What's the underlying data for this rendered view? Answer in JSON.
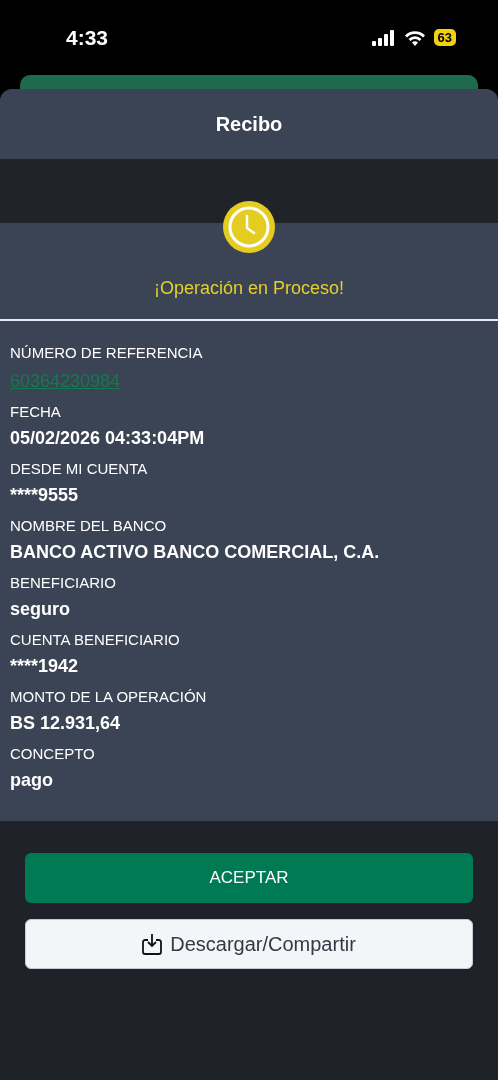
{
  "status_bar": {
    "time": "4:33",
    "battery": "63"
  },
  "header": {
    "title": "Recibo"
  },
  "status": {
    "text": "¡Operación en Proceso!"
  },
  "fields": [
    {
      "label": "NÚMERO DE REFERENCIA",
      "value": "60364230984",
      "kind": "link"
    },
    {
      "label": "FECHA",
      "value": "05/02/2026 04:33:04PM",
      "kind": "text"
    },
    {
      "label": "DESDE MI CUENTA",
      "value": "****9555",
      "kind": "text"
    },
    {
      "label": "NOMBRE DEL BANCO",
      "value": "BANCO ACTIVO BANCO COMERCIAL, C.A.",
      "kind": "text"
    },
    {
      "label": "BENEFICIARIO",
      "value": "seguro",
      "kind": "text"
    },
    {
      "label": "CUENTA BENEFICIARIO",
      "value": "****1942",
      "kind": "text"
    },
    {
      "label": "MONTO DE LA OPERACIÓN",
      "value": "BS 12.931,64",
      "kind": "text"
    },
    {
      "label": "CONCEPTO",
      "value": "pago",
      "kind": "text"
    }
  ],
  "buttons": [
    {
      "label": "ACEPTAR",
      "kind": "primary"
    },
    {
      "label": "Descargar/Compartir",
      "kind": "download"
    }
  ]
}
